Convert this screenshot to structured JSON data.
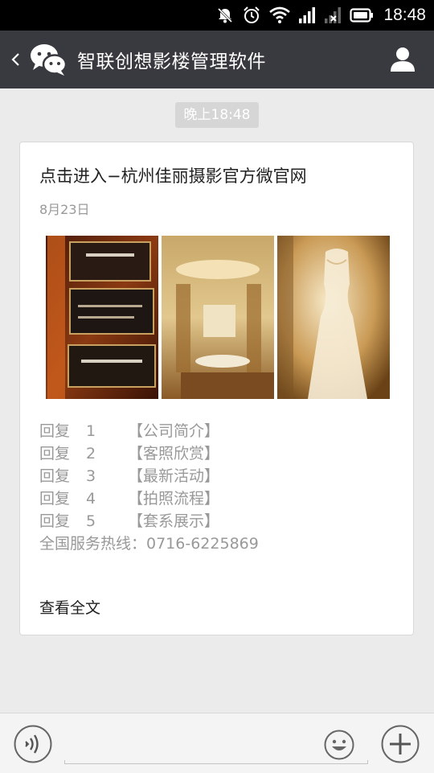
{
  "status_bar": {
    "time": "18:48",
    "icons": [
      "notification-muted-icon",
      "alarm-icon",
      "wifi-icon",
      "signal-icon",
      "signal-no-sim-icon",
      "battery-icon"
    ]
  },
  "header": {
    "title": "智联创想影楼管理软件",
    "icons": [
      "back-icon",
      "wechat-icon",
      "profile-icon"
    ]
  },
  "chat": {
    "timestamp": "晚上18:48"
  },
  "article": {
    "title": "点击进入−杭州佳丽摄影官方微官网",
    "date": "8月23日",
    "replies": [
      {
        "prefix": "回复",
        "number": "1",
        "label": "【公司简介】"
      },
      {
        "prefix": "回复",
        "number": "2",
        "label": "【客照欣赏】"
      },
      {
        "prefix": "回复",
        "number": "3",
        "label": "【最新活动】"
      },
      {
        "prefix": "回复",
        "number": "4",
        "label": "【拍照流程】"
      },
      {
        "prefix": "回复",
        "number": "5",
        "label": "【套系展示】"
      }
    ],
    "hotline": "全国服务热线：0716-6225869",
    "read_more": "查看全文"
  },
  "input_bar": {
    "icons": [
      "voice-icon",
      "emoji-icon",
      "plus-icon"
    ]
  },
  "colors": {
    "title_bar": "#393a3f",
    "background": "#ebebeb",
    "muted_text": "#999999"
  }
}
